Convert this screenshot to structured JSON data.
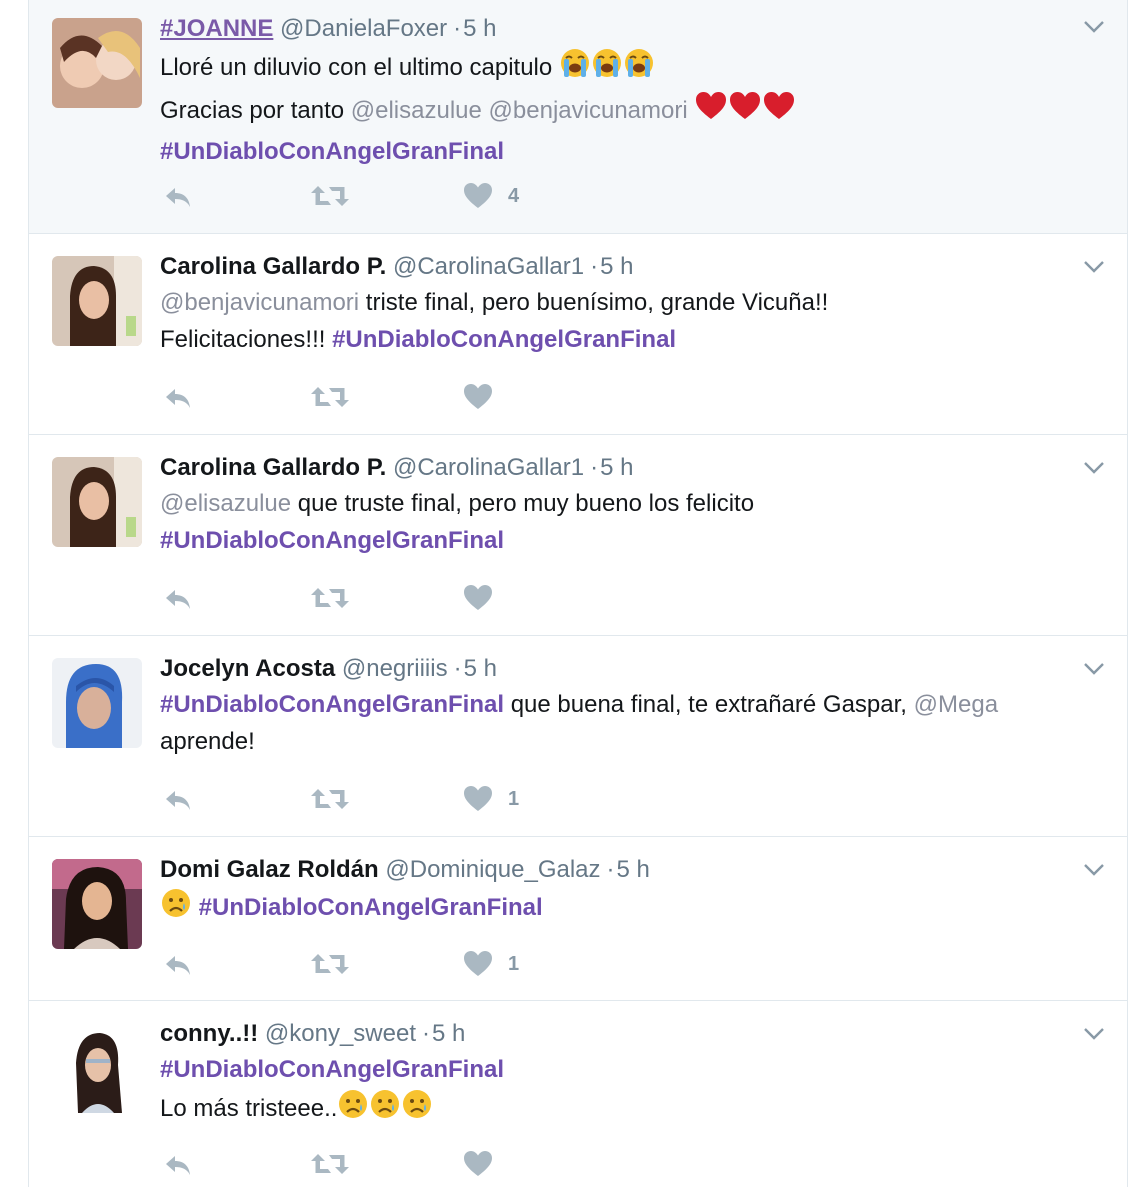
{
  "colors": {
    "hashtag": "#6e4fae",
    "mention": "#8a8f9c",
    "icon": "#aab8c2",
    "border": "#e1e8ed"
  },
  "tweets": [
    {
      "name": "#JOANNE",
      "handle": "@DanielaFoxer",
      "time": "5 h",
      "line1": {
        "t1": "Lloré un diluvio con el ultimo capitulo",
        "emoji": "loudly-crying-face x3"
      },
      "line2": {
        "t1": "Gracias por tanto",
        "m1": "@elisazulue",
        "m2": "@benjavicunamori",
        "emoji": "red-heart x3"
      },
      "line3": {
        "h1": "#UnDiabloConAngelGranFinal"
      },
      "likes": "4"
    },
    {
      "name": "Carolina Gallardo P.",
      "handle": "@CarolinaGallar1",
      "time": "5 h",
      "line1": {
        "m1": "@benjavicunamori",
        "t1": " triste final, pero buenísimo, grande Vicuña!!"
      },
      "line2": {
        "t1": "Felicitaciones!!!",
        "h1": "#UnDiabloConAngelGranFinal"
      },
      "likes": ""
    },
    {
      "name": "Carolina Gallardo P.",
      "handle": "@CarolinaGallar1",
      "time": "5 h",
      "line1": {
        "m1": "@elisazulue",
        "t1": "que truste final, pero muy bueno los felicito"
      },
      "line2": {
        "h1": "#UnDiabloConAngelGranFinal"
      },
      "likes": ""
    },
    {
      "name": "Jocelyn Acosta",
      "handle": "@negriiiis",
      "time": "5 h",
      "line1": {
        "h1": "#UnDiabloConAngelGranFinal",
        "t1": "que buena final, te extrañaré Gaspar,",
        "m1": "@Mega"
      },
      "line2": {
        "t1": "aprende!"
      },
      "likes": "1"
    },
    {
      "name": "Domi Galaz Roldán",
      "handle": "@Dominique_Galaz",
      "time": "5 h",
      "line1": {
        "emoji": "crying-face",
        "h1": "#UnDiabloConAngelGranFinal"
      },
      "likes": "1"
    },
    {
      "name": "conny..!!",
      "handle": "@kony_sweet",
      "time": "5 h",
      "line1": {
        "h1": "#UnDiabloConAngelGranFinal"
      },
      "line2": {
        "t1": "Lo más tristeee..",
        "emoji": "crying-face x3"
      },
      "likes": ""
    }
  ]
}
